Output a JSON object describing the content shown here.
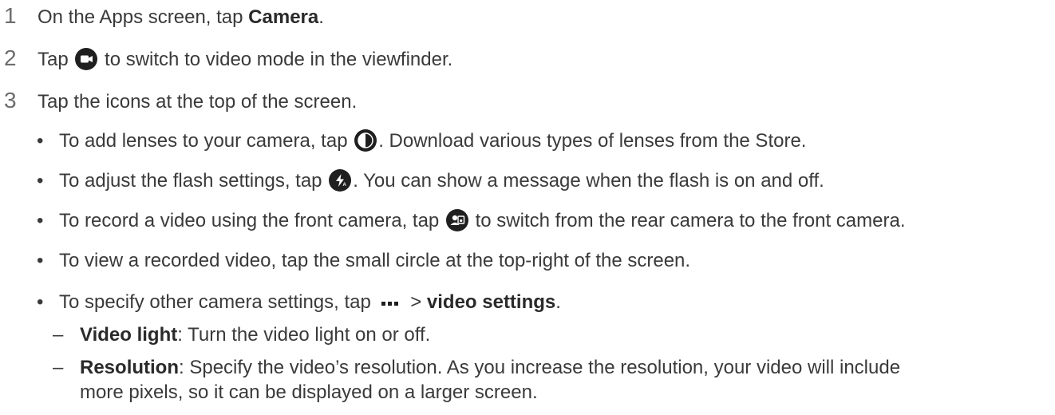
{
  "steps": [
    {
      "num": "1",
      "pre": "On the Apps screen, tap ",
      "bold": "Camera",
      "post": "."
    },
    {
      "num": "2",
      "pre": "Tap ",
      "post": " to switch to video mode in the viewfinder."
    },
    {
      "num": "3",
      "text": "Tap the icons at the top of the screen."
    }
  ],
  "bullets": [
    {
      "pre": "To add lenses to your camera, tap ",
      "post": ". Download various types of lenses from the Store."
    },
    {
      "pre": "To adjust the flash settings, tap ",
      "post": ". You can show a message when the flash is on and off."
    },
    {
      "pre": "To record a video using the front camera, tap ",
      "post": " to switch from the rear camera to the front camera."
    },
    {
      "text": "To view a recorded video, tap the small circle at the top-right of the screen."
    },
    {
      "pre": "To specify other camera settings, tap ",
      "mid": " > ",
      "bold": "video settings",
      "post": "."
    }
  ],
  "subitems": [
    {
      "bold": "Video light",
      "text": ": Turn the video light on or off."
    },
    {
      "bold": "Resolution",
      "text": ": Specify the video’s resolution. As you increase the resolution, your video will include",
      "text2": "more pixels, so it can be displayed on a larger screen."
    }
  ],
  "bullet_char": "•",
  "dash_char": "–",
  "icons": {
    "video": "video-camera-icon",
    "lens": "lens-icon",
    "flash": "flash-icon",
    "switch": "switch-camera-icon",
    "more": "more-dots-icon"
  }
}
